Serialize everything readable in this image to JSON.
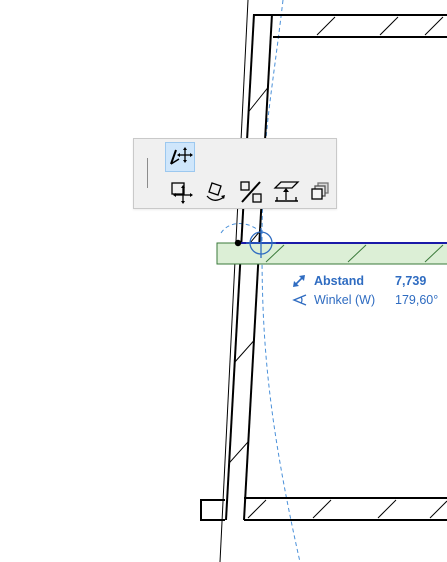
{
  "pet_palette": {
    "tools": [
      {
        "icon": "drag-vertex-icon",
        "active": true
      },
      {
        "icon": "move-icon",
        "active": false
      },
      {
        "icon": "rotate-icon",
        "active": false
      },
      {
        "icon": "mirror-icon",
        "active": false
      },
      {
        "icon": "elevate-icon",
        "active": false
      },
      {
        "icon": "multiply-icon",
        "active": false
      }
    ]
  },
  "tracker": {
    "distance": {
      "label": "Abstand",
      "value": "7,739",
      "icon": "distance-icon"
    },
    "angle": {
      "label": "Winkel (W)",
      "value": "179,60°",
      "icon": "angle-icon"
    }
  },
  "colors": {
    "accent": "#2f6cc1",
    "wall_line": "#000000",
    "preview_fill": "#dcefd6",
    "preview_outline": "#3a7a3a",
    "guide_line": "#4a90d9"
  }
}
